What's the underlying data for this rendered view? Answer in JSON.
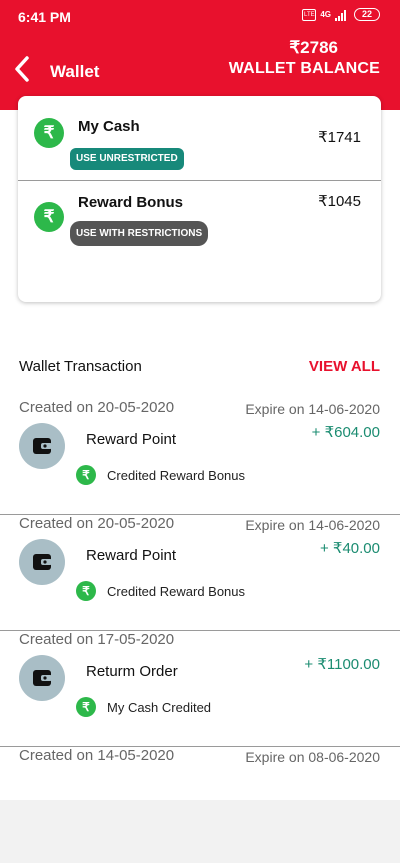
{
  "status_bar": {
    "time": "6:41 PM",
    "lte": "LTE",
    "network": "4G",
    "battery": "22"
  },
  "header": {
    "title": "Wallet",
    "balance_amount": "₹2786",
    "balance_label": "WALLET BALANCE"
  },
  "wallet_card": {
    "cash": {
      "title": "My Cash",
      "badge": "USE UNRESTRICTED",
      "amount": "₹1741"
    },
    "reward": {
      "title": "Reward Bonus",
      "badge": "USE WITH RESTRICTIONS",
      "amount": "₹1045"
    },
    "icon": "₹"
  },
  "transactions_section": {
    "title": "Wallet Transaction",
    "view_all": "VIEW ALL"
  },
  "transactions": [
    {
      "created": "Created on 20-05-2020",
      "expire": "Expire on 14-06-2020",
      "name": "Reward Point",
      "amount": "+ ₹604.00",
      "sub": "Credited Reward Bonus"
    },
    {
      "created": "Created on 20-05-2020",
      "expire": "Expire on 14-06-2020",
      "name": "Reward Point",
      "amount": "+ ₹40.00",
      "sub": "Credited Reward Bonus"
    },
    {
      "created": "Created on 17-05-2020",
      "expire": "",
      "name": "Returm Order",
      "amount": "+ ₹1100.00",
      "sub": "My Cash Credited"
    },
    {
      "created": "Created on 14-05-2020",
      "expire": "Expire on 08-06-2020"
    }
  ],
  "colors": {
    "brand": "#e8112d",
    "green": "#2db84a",
    "teal": "#17897a",
    "credit": "#1b8c71"
  }
}
